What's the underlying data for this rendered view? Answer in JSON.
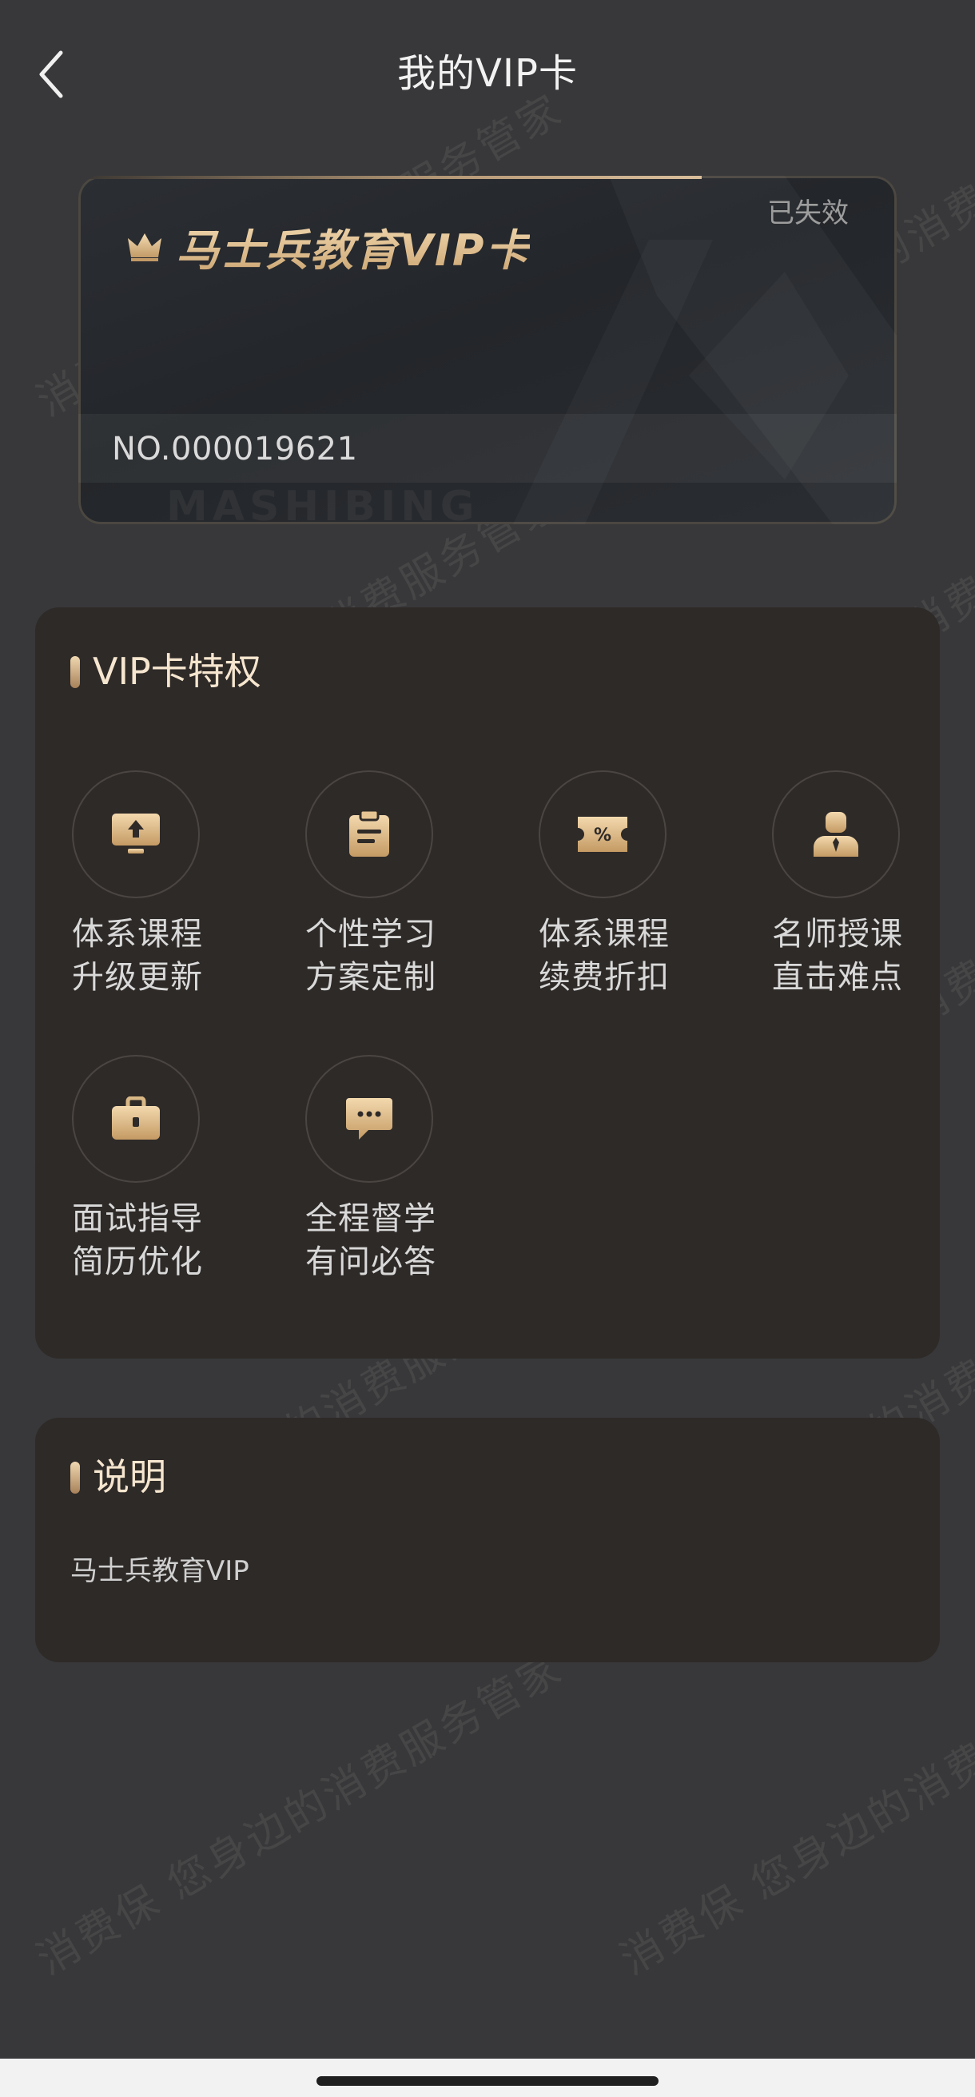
{
  "header": {
    "title": "我的VIP卡"
  },
  "card": {
    "name": "马士兵教育VIP卡",
    "status": "已失效",
    "number": "NO.000019621",
    "brand_watermark": "MASHIBING"
  },
  "privileges": {
    "title": "VIP卡特权",
    "items": [
      {
        "label": "体系课程\n升级更新",
        "icon": "upload-screen-icon"
      },
      {
        "label": "个性学习\n方案定制",
        "icon": "clipboard-icon"
      },
      {
        "label": "体系课程\n续费折扣",
        "icon": "discount-ticket-icon"
      },
      {
        "label": "名师授课\n直击难点",
        "icon": "teacher-icon"
      },
      {
        "label": "面试指导\n简历优化",
        "icon": "briefcase-icon"
      },
      {
        "label": "全程督学\n有问必答",
        "icon": "chat-bubble-icon"
      }
    ]
  },
  "notes": {
    "title": "说明",
    "text": "马士兵教育VIP"
  },
  "watermark": {
    "text": "消费保 您身边的消费服务管家"
  },
  "colors": {
    "background": "#38383a",
    "panel": "#2e2a28",
    "gold": "#dcb987",
    "gold_light": "#f6e6cf"
  }
}
